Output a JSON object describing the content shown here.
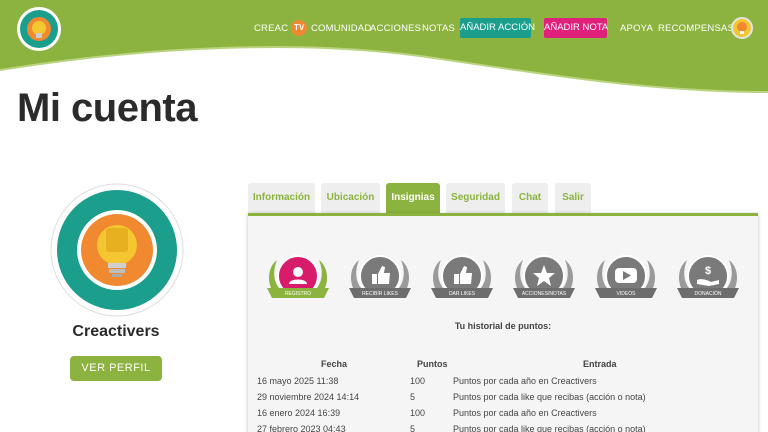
{
  "header": {
    "nav": {
      "creac": "CREAC",
      "tv": "TV",
      "comunidad": "COMUNIDAD",
      "acciones": "ACCIONES",
      "notas": "NOTAS",
      "anadir_accion": "AÑADIR ACCIÓN",
      "anadir_nota": "AÑADIR NOTA",
      "apoya": "APOYA",
      "recompensas": "RECOMPENSAS"
    },
    "colors": {
      "green": "#8cb33f",
      "teal": "#1c9e8d",
      "pink": "#e0217b",
      "orange": "#f0892f"
    }
  },
  "page": {
    "title": "Mi cuenta"
  },
  "profile": {
    "name": "Creactivers",
    "button": "VER PERFIL"
  },
  "tabs": [
    {
      "label": "Información",
      "active": false
    },
    {
      "label": "Ubicación",
      "active": false
    },
    {
      "label": "Insignias",
      "active": true
    },
    {
      "label": "Seguridad",
      "active": false
    },
    {
      "label": "Chat",
      "active": false
    },
    {
      "label": "Salir",
      "active": false
    }
  ],
  "badges": [
    {
      "label": "REGISTRO",
      "icon": "user-icon",
      "earned": true
    },
    {
      "label": "RECIBIR LIKES",
      "icon": "thumbs-up-icon",
      "earned": false
    },
    {
      "label": "DAR LIKES",
      "icon": "thumbs-up-icon",
      "earned": false
    },
    {
      "label": "ACCIONES/NOTAS",
      "icon": "star-icon",
      "earned": false
    },
    {
      "label": "VIDEOS",
      "icon": "play-icon",
      "earned": false
    },
    {
      "label": "DONACIÓN",
      "icon": "donation-icon",
      "earned": false
    }
  ],
  "history": {
    "title": "Tu historial de puntos:",
    "columns": {
      "date": "Fecha",
      "points": "Puntos",
      "entry": "Entrada"
    },
    "rows": [
      {
        "date": "16 mayo 2025 11:38",
        "points": "100",
        "entry": "Puntos por cada año en Creactivers"
      },
      {
        "date": "29 noviembre 2024 14:14",
        "points": "5",
        "entry": "Puntos por cada like que recibas (acción o nota)"
      },
      {
        "date": "16 enero 2024 16:39",
        "points": "100",
        "entry": "Puntos por cada año en Creactivers"
      },
      {
        "date": "27 febrero 2023 04:43",
        "points": "5",
        "entry": "Puntos por cada like que recibas (acción o nota)"
      }
    ]
  }
}
